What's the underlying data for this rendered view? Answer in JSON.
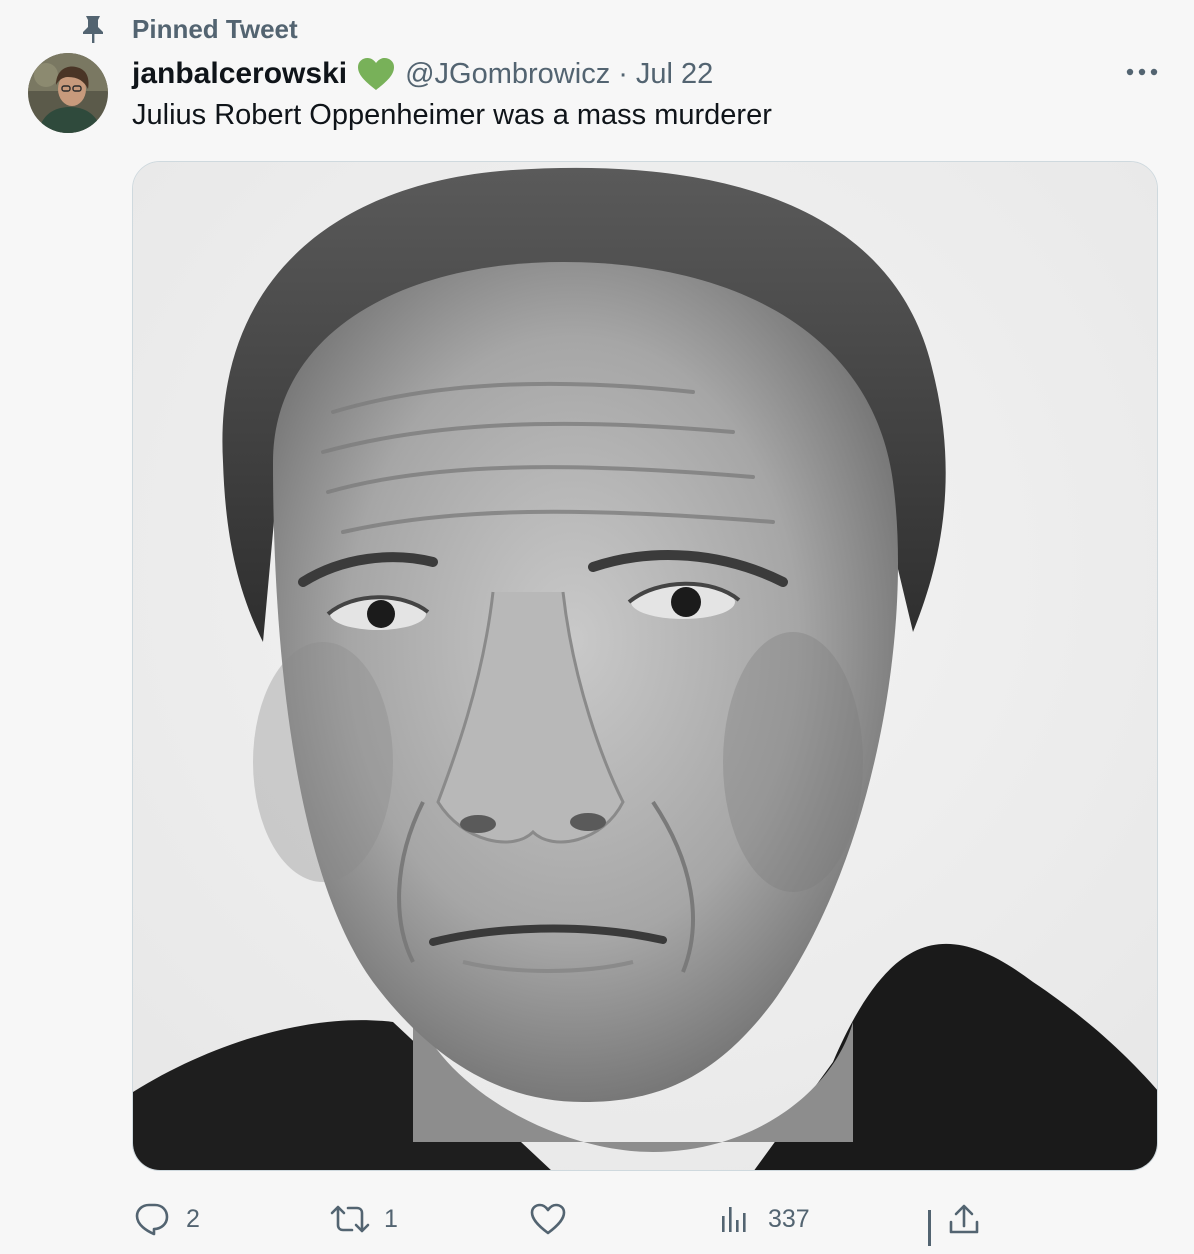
{
  "pinned": {
    "label": "Pinned Tweet"
  },
  "tweet": {
    "display_name": "janbalcerowski",
    "badge_icon": "green-heart-icon",
    "handle": "@JGombrowicz",
    "separator": "·",
    "date": "Jul 22",
    "text": "Julius Robert Oppenheimer was a mass murderer",
    "media_type": "black-and-white portrait photo"
  },
  "actions": {
    "reply": {
      "icon": "reply-icon",
      "count": "2"
    },
    "retweet": {
      "icon": "retweet-icon",
      "count": "1"
    },
    "like": {
      "icon": "heart-outline-icon",
      "count": ""
    },
    "views": {
      "icon": "analytics-icon",
      "count": "337"
    },
    "share": {
      "icon": "share-icon"
    }
  },
  "colors": {
    "secondary_text": "#536471",
    "primary_text": "#0f1419",
    "heart_green": "#78b159",
    "background": "#f7f7f7"
  }
}
